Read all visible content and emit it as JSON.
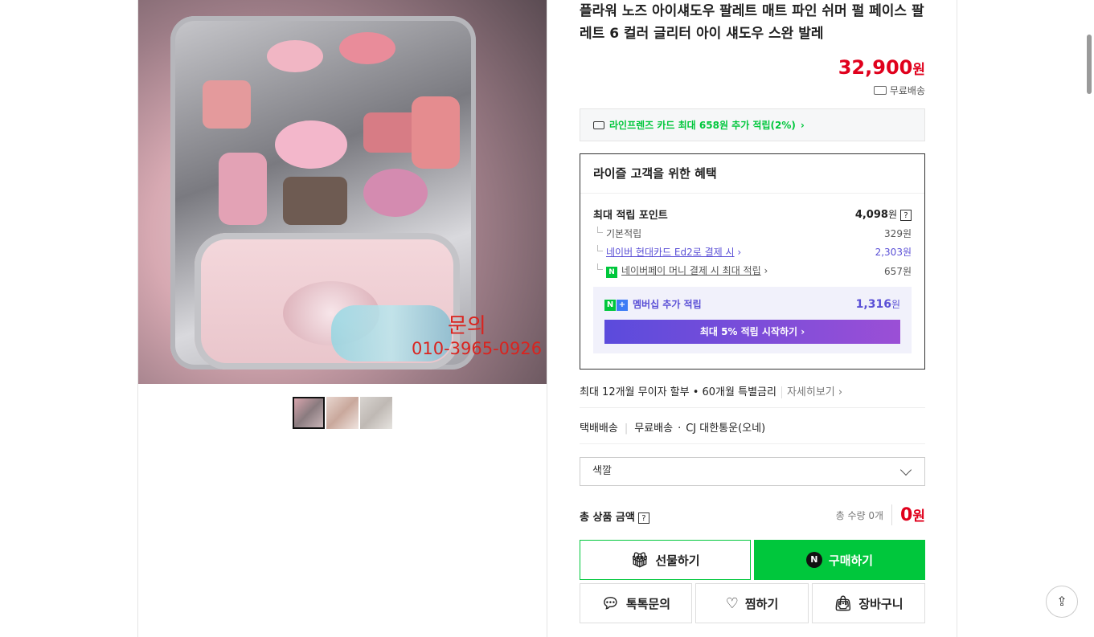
{
  "product": {
    "title": "플라워 노즈 아이섀도우 팔레트 매트 파인 쉬머 펄 페이스 팔레트 6 컬러 글리터 아이 섀도우 스완 발레",
    "price": "32,900",
    "price_unit": "원",
    "shipping": "무료배송",
    "image_watermark_1": "문의",
    "image_watermark_2": "010-3965-0926"
  },
  "card_promo": "라인프렌즈 카드 최대 658원 추가 적립(2%)",
  "benefits": {
    "heading": "라이즐 고객을 위한 혜택",
    "max_points_label": "최대 적립 포인트",
    "max_points_value": "4,098",
    "unit": "원",
    "help": "?",
    "base_label": "기본적립",
    "base_value": "329원",
    "card_label": "네이버 현대카드 Ed2로 결제 시",
    "card_value": "2,303원",
    "npay_badge": "N",
    "npay_label": "네이버페이 머니 결제 시 최대 적립",
    "npay_value": "657원",
    "membership_label": "멤버십 추가 적립",
    "membership_value": "1,316",
    "membership_badge_n": "N",
    "membership_badge_plus": "+",
    "membership_button": "최대 5% 적립 시작하기"
  },
  "installment": {
    "text": "최대 12개월 무이자 할부 • 60개월 특별금리",
    "more": "자세히보기"
  },
  "delivery": {
    "type": "택배배송",
    "fee": "무료배송",
    "carrier": "CJ 대한통운(오네)"
  },
  "option_select": {
    "label": "색깔"
  },
  "total": {
    "label": "총 상품 금액",
    "help": "?",
    "qty": "총 수량 0개",
    "amount": "0",
    "unit": "원"
  },
  "buttons": {
    "gift": "선물하기",
    "buy": "구매하기",
    "buy_badge": "N",
    "talk": "톡톡문의",
    "zzim": "찜하기",
    "cart": "장바구니"
  },
  "icons": {
    "share": "share-icon",
    "gift": "gift-icon",
    "talk": "chat-icon",
    "zzim": "heart-icon",
    "cart": "bag-icon"
  },
  "colors": {
    "accent_green": "#00c73c",
    "price_red": "#e0001c",
    "member_purple": "#5a4fd6"
  }
}
